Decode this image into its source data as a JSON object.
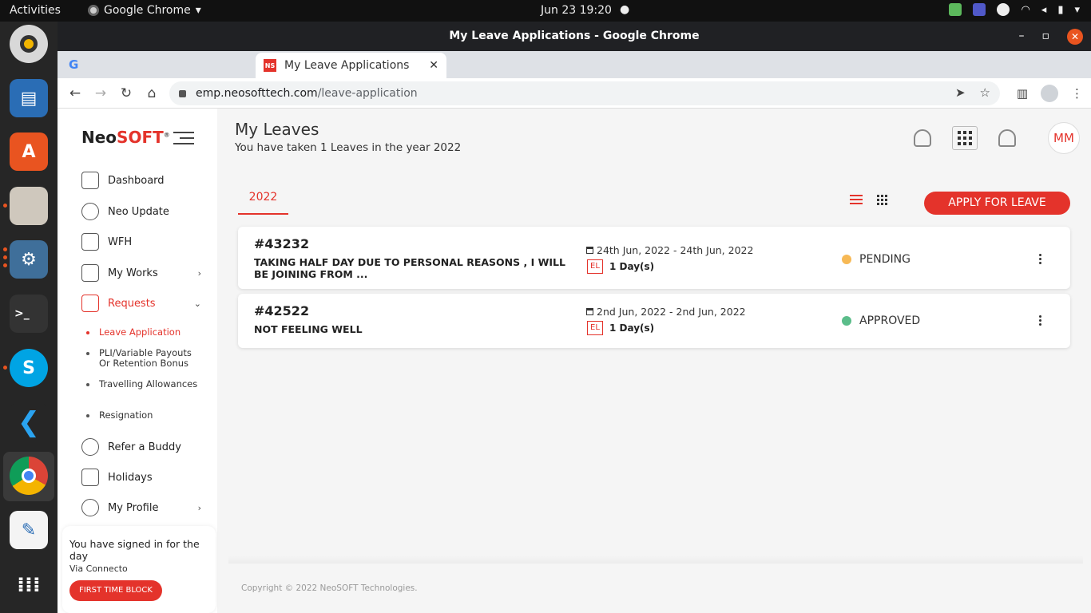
{
  "system": {
    "activities": "Activities",
    "app_name": "Google Chrome",
    "clock": "Jun 23  19:20"
  },
  "window": {
    "title": "My Leave Applications - Google Chrome"
  },
  "tabs": {
    "active_favicon": "NS",
    "active_label": "My Leave Applications",
    "close": "✕"
  },
  "address": {
    "host": "emp.neosofttech.com",
    "path": "/leave-application"
  },
  "sidebar": {
    "logo_neo": "Neo",
    "logo_soft": "SOFT",
    "logo_reg": "®",
    "items": [
      {
        "label": "Dashboard",
        "icon": "dashboard-icon"
      },
      {
        "label": "Neo Update",
        "icon": "megaphone-icon"
      },
      {
        "label": "WFH",
        "icon": "wfh-icon"
      },
      {
        "label": "My Works",
        "icon": "works-icon"
      },
      {
        "label": "Requests",
        "icon": "requests-icon"
      },
      {
        "label": "Refer a Buddy",
        "icon": "refer-icon"
      },
      {
        "label": "Holidays",
        "icon": "holidays-icon"
      },
      {
        "label": "My Profile",
        "icon": "profile-icon"
      }
    ],
    "sub_items": [
      "Leave Application",
      "PLI/Variable Payouts Or Retention Bonus",
      "Travelling Allowances",
      "Resignation"
    ],
    "signin": {
      "text": "You have signed in for the day",
      "via": "Via Connecto",
      "button": "FIRST TIME BLOCK"
    }
  },
  "header": {
    "title": "My Leaves",
    "subtitle": "You have taken 1 Leaves in the year 2022",
    "avatar": "MM"
  },
  "tabs_row": {
    "year": "2022",
    "apply": "APPLY FOR LEAVE"
  },
  "leaves": [
    {
      "id": "#43232",
      "reason": "TAKING HALF DAY DUE TO PERSONAL REASONS , I WILL BE JOINING FROM ...",
      "dates": "24th Jun, 2022 - 24th Jun, 2022",
      "type": "EL",
      "days": "1 Day(s)",
      "status": "PENDING",
      "status_color": "#f7b955"
    },
    {
      "id": "#42522",
      "reason": "NOT FEELING WELL",
      "dates": "2nd Jun, 2022 - 2nd Jun, 2022",
      "type": "EL",
      "days": "1 Day(s)",
      "status": "APPROVED",
      "status_color": "#5bbd8a"
    }
  ],
  "footer": {
    "copyright": "Copyright © 2022 NeoSOFT Technologies."
  },
  "colors": {
    "accent": "#e4332b"
  }
}
